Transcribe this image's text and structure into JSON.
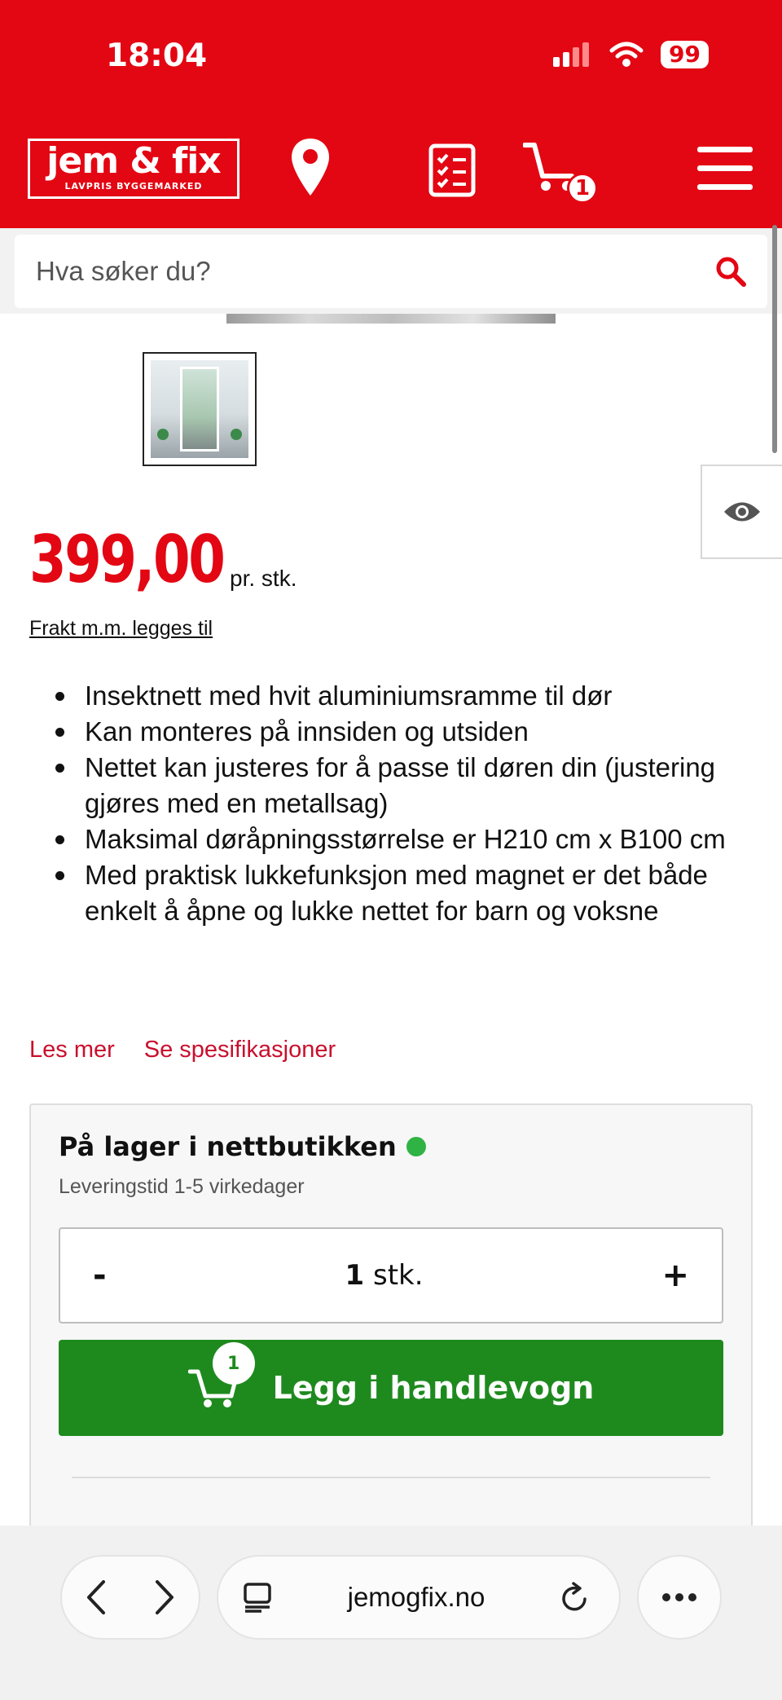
{
  "status_bar": {
    "time": "18:04",
    "battery": "99"
  },
  "header": {
    "logo_text": "jem & fix",
    "logo_subtitle": "LAVPRIS BYGGEMARKED",
    "cart_count": "1"
  },
  "search": {
    "placeholder": "Hva søker du?"
  },
  "product": {
    "price": "399,00",
    "price_unit": "pr. stk.",
    "freight_link": "Frakt m.m. legges til",
    "bullets": [
      "Insektnett med hvit aluminiumsramme til dør",
      "Kan monteres på innsiden og utsiden",
      "Nettet kan justeres for å passe til døren din (justering gjøres med en metallsag)",
      "Maksimal døråpningsstørrelse er H210 cm x B100 cm",
      "Med praktisk lukkefunksjon med magnet er det både enkelt å åpne og lukke nettet for barn og voksne"
    ],
    "read_more": "Les mer",
    "specs_link": "Se spesifikasjoner"
  },
  "stock": {
    "title": "På lager i nettbutikken",
    "delivery": "Leveringstid 1-5 virkedager",
    "qty_minus": "-",
    "qty_value": "1",
    "qty_unit": "stk.",
    "qty_plus": "+",
    "add_button": "Legg i handlevogn",
    "add_badge": "1",
    "status_color": "#2fb344"
  },
  "browser": {
    "url": "jemogfix.no"
  },
  "colors": {
    "brand": "#e30613",
    "cta": "#1e8a1e",
    "link": "#c8102e"
  }
}
